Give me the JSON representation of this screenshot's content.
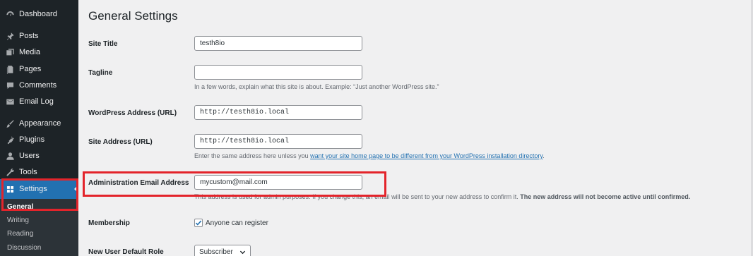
{
  "sidebar": {
    "items": [
      {
        "label": "Dashboard",
        "icon": "dashboard-icon"
      },
      {
        "label": "Posts",
        "icon": "pin-icon"
      },
      {
        "label": "Media",
        "icon": "media-icon"
      },
      {
        "label": "Pages",
        "icon": "pages-icon"
      },
      {
        "label": "Comments",
        "icon": "comment-icon"
      },
      {
        "label": "Email Log",
        "icon": "email-icon"
      },
      {
        "label": "Appearance",
        "icon": "brush-icon"
      },
      {
        "label": "Plugins",
        "icon": "plugin-icon"
      },
      {
        "label": "Users",
        "icon": "users-icon"
      },
      {
        "label": "Tools",
        "icon": "wrench-icon"
      },
      {
        "label": "Settings",
        "icon": "settings-icon",
        "active": true
      }
    ],
    "submenu": [
      "General",
      "Writing",
      "Reading",
      "Discussion"
    ],
    "current_submenu": "General"
  },
  "main": {
    "title": "General Settings",
    "site_title": {
      "label": "Site Title",
      "value": "testh8io"
    },
    "tagline": {
      "label": "Tagline",
      "value": "",
      "desc": "In a few words, explain what this site is about. Example: “Just another WordPress site.”"
    },
    "wp_address": {
      "label": "WordPress Address (URL)",
      "value": "http://testh8io.local"
    },
    "site_address": {
      "label": "Site Address (URL)",
      "value": "http://testh8io.local",
      "desc_prefix": "Enter the same address here unless you ",
      "desc_link": "want your site home page to be different from your WordPress installation directory",
      "desc_suffix": "."
    },
    "admin_email": {
      "label": "Administration Email Address",
      "value": "mycustom@mail.com",
      "desc": "This address is used for admin purposes. If you change this, an email will be sent to your new address to confirm it. ",
      "desc_strong": "The new address will not become active until confirmed."
    },
    "membership": {
      "label": "Membership",
      "checkbox_label": "Anyone can register",
      "checked": true
    },
    "default_role": {
      "label": "New User Default Role",
      "value": "Subscriber"
    }
  },
  "colors": {
    "sidebar_bg": "#1d2327",
    "active_bg": "#2271b1",
    "highlight": "#e3242b",
    "link": "#2271b1"
  }
}
